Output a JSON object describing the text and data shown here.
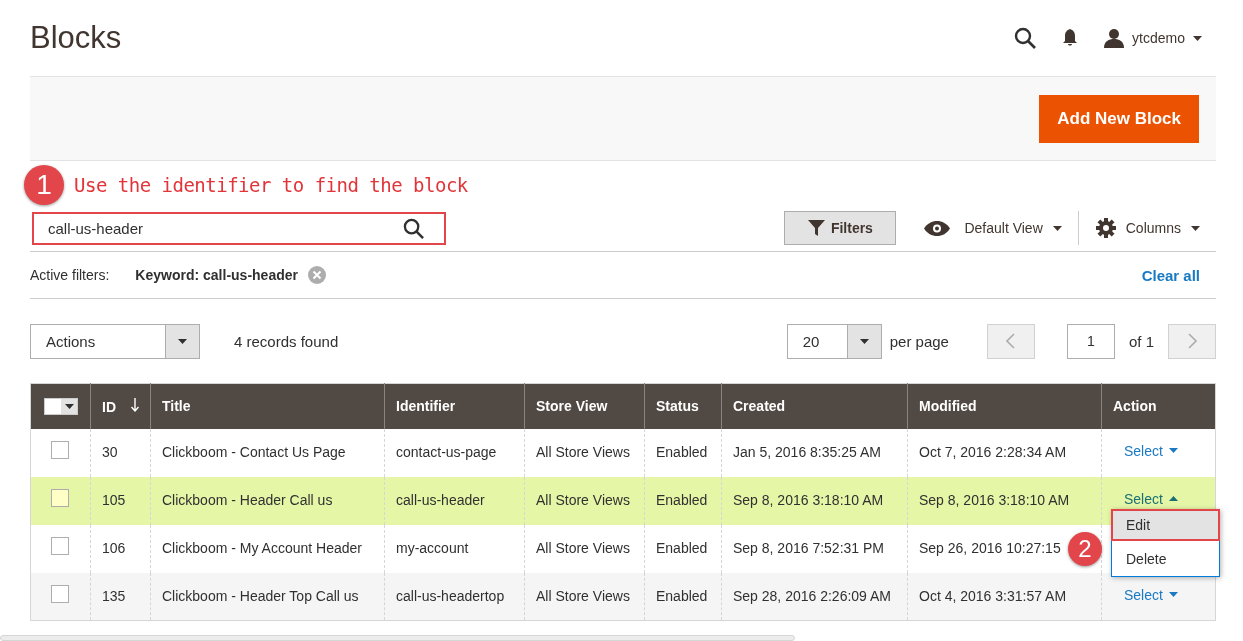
{
  "page_title": "Blocks",
  "header": {
    "user": "ytcdemo"
  },
  "add_button": "Add New Block",
  "search_annotation": {
    "badge": "1",
    "text": "Use the identifier to find the block"
  },
  "search": {
    "value": "call-us-header"
  },
  "toolbar": {
    "filters": "Filters",
    "view": "Default View",
    "columns": "Columns"
  },
  "active_filters": {
    "label": "Active filters:",
    "chips": [
      {
        "text": "Keyword: call-us-header"
      }
    ],
    "clear": "Clear all"
  },
  "actions": {
    "label": "Actions",
    "count": "4 records found",
    "per_page": "20",
    "per_page_label": "per page",
    "page": "1",
    "of": "of 1"
  },
  "menu_annotation": {
    "badge": "2"
  },
  "table": {
    "select_all": {
      "checked": false
    },
    "columns": [
      {
        "label": "ID",
        "sorted": true
      },
      {
        "label": "Title",
        "sorted": false
      },
      {
        "label": "Identifier",
        "sorted": false
      },
      {
        "label": "Store View",
        "sorted": false
      },
      {
        "label": "Status",
        "sorted": false
      },
      {
        "label": "Created",
        "sorted": false
      },
      {
        "label": "Modified",
        "sorted": false
      },
      {
        "label": "Action",
        "sorted": false
      }
    ],
    "rows": [
      {
        "checked": false,
        "highlighted": false,
        "cells": [
          "30",
          "Clickboom - Contact Us Page",
          "contact-us-page",
          "All Store Views",
          "Enabled",
          "Jan 5, 2016 8:35:25 AM",
          "Oct 7, 2016 2:28:34 AM"
        ],
        "action": "Select",
        "expanded": false
      },
      {
        "checked": false,
        "highlighted": true,
        "cells": [
          "105",
          "Clickboom - Header Call us",
          "call-us-header",
          "All Store Views",
          "Enabled",
          "Sep 8, 2016 3:18:10 AM",
          "Sep 8, 2016 3:18:10 AM"
        ],
        "action": "Select",
        "expanded": true,
        "menu": [
          {
            "label": "Edit",
            "selected": true
          },
          {
            "label": "Delete",
            "selected": false
          }
        ]
      },
      {
        "checked": false,
        "highlighted": false,
        "cells": [
          "106",
          "Clickboom - My Account Header",
          "my-account",
          "All Store Views",
          "Enabled",
          "Sep 8, 2016 7:52:31 PM",
          "Sep 26, 2016 10:27:15"
        ]
      },
      {
        "checked": false,
        "highlighted": false,
        "cells": [
          "135",
          "Clickboom - Header Top Call us",
          "call-us-headertop",
          "All Store Views",
          "Enabled",
          "Sep 28, 2016 2:26:09 AM",
          "Oct 4, 2016 3:31:57 AM"
        ],
        "action": "Select",
        "expanded": false
      }
    ]
  }
}
